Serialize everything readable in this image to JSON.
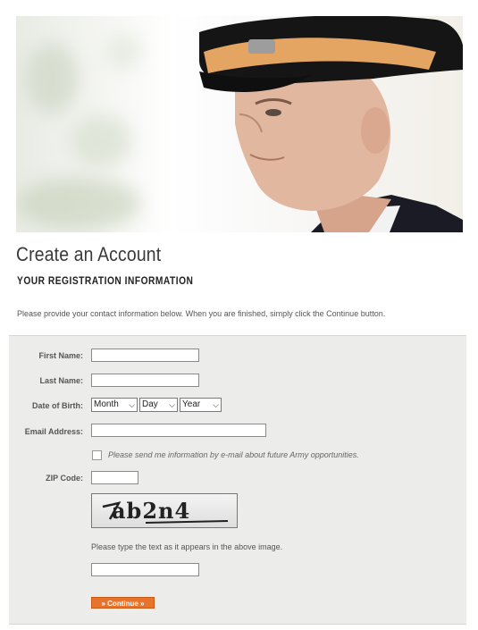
{
  "page": {
    "title": "Create an Account",
    "subtitle": "YOUR REGISTRATION INFORMATION",
    "intro": "Please provide your contact information below. When you are finished, simply click the Continue button."
  },
  "form": {
    "first_name_label": "First Name:",
    "last_name_label": "Last Name:",
    "dob_label": "Date of Birth:",
    "month_value": "Month",
    "day_value": "Day",
    "year_value": "Year",
    "email_label": "Email Address:",
    "optin_text": "Please send me information by e-mail about future Army opportunities.",
    "zip_label": "ZIP Code:",
    "captcha_text": "ab2n4",
    "captcha_hint": "Please type the text as it appears in the above image.",
    "continue_label": "» Continue »"
  },
  "colors": {
    "accent": "#e8732a",
    "form_bg": "#ececea"
  }
}
